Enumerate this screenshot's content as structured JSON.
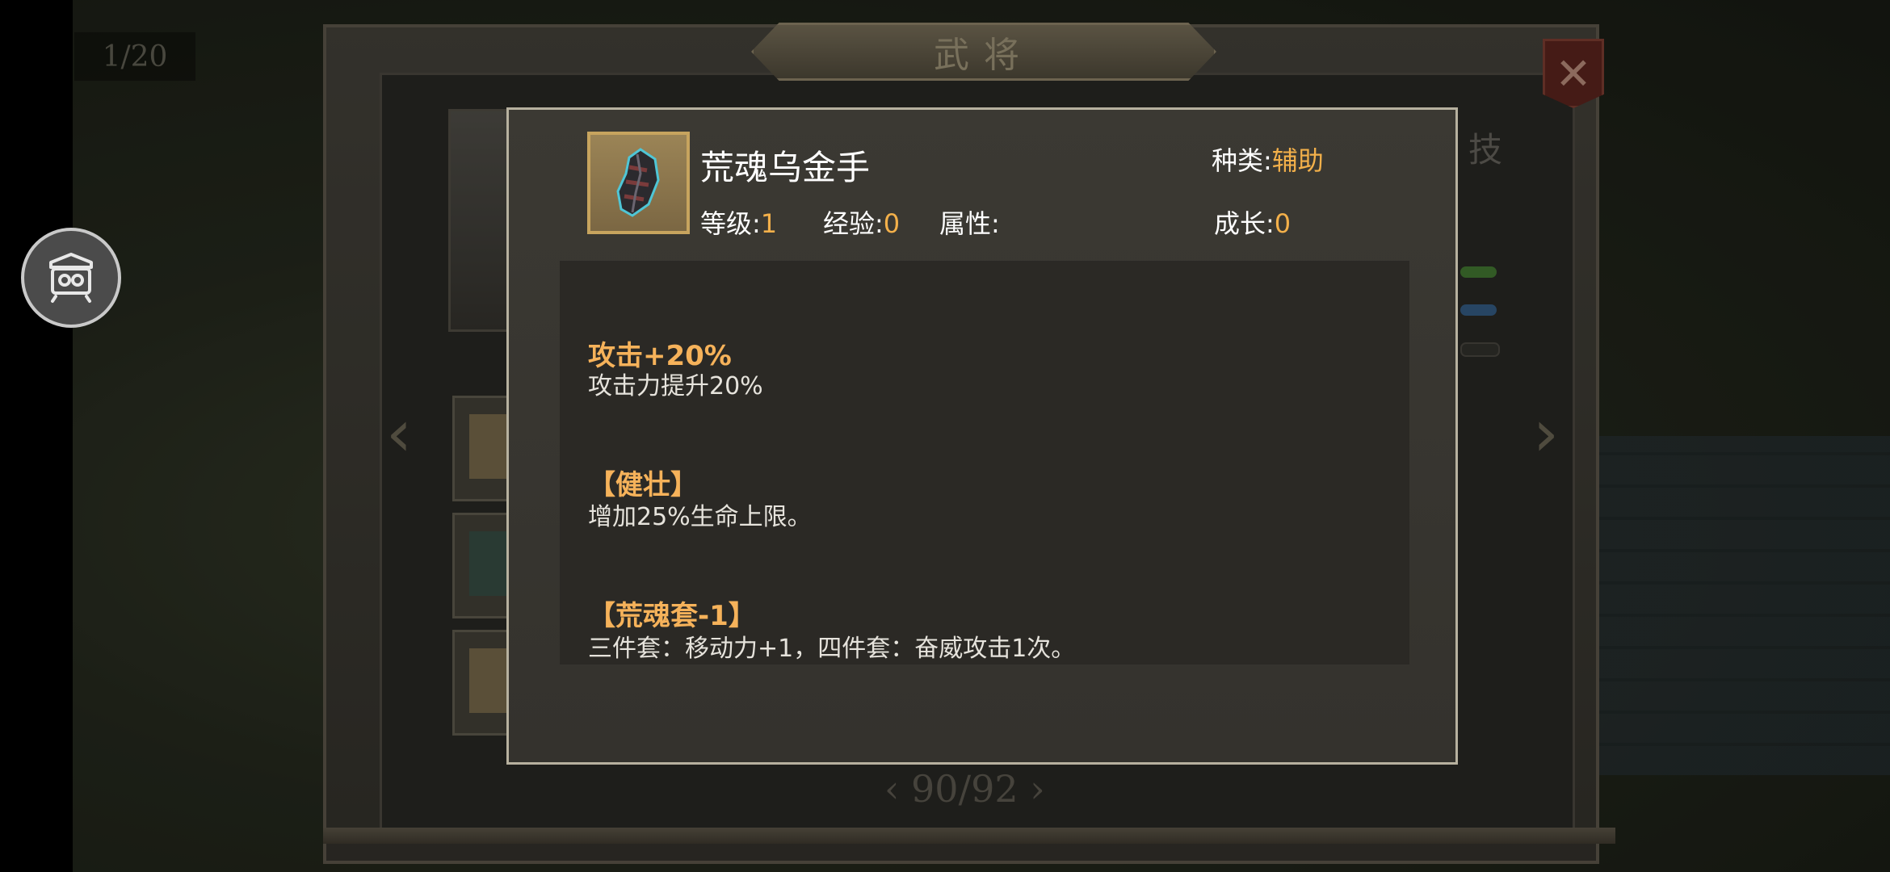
{
  "background": {
    "page_counter": "1/20",
    "title": "武将",
    "skill_tab": "技",
    "pager": {
      "current": "90/92"
    }
  },
  "item": {
    "name": "荒魂乌金手",
    "category_label": "种类:",
    "category_value": "辅助",
    "level_label": "等级:",
    "level_value": "1",
    "exp_label": "经验:",
    "exp_value": "0",
    "attribute_label": "属性:",
    "attribute_value": "",
    "growth_label": "成长:",
    "growth_value": "0"
  },
  "effects": [
    {
      "title": "攻击+20%",
      "desc": "攻击力提升20%"
    },
    {
      "title": "【健壮】",
      "desc": "增加25%生命上限。"
    },
    {
      "title": "【荒魂套-1】",
      "desc": "三件套：移动力+1，四件套：奋威攻击1次。"
    }
  ],
  "colors": {
    "accent_value": "#f3b04a",
    "effect_title": "#f6b25a",
    "popup_border": "#b7b19f"
  }
}
